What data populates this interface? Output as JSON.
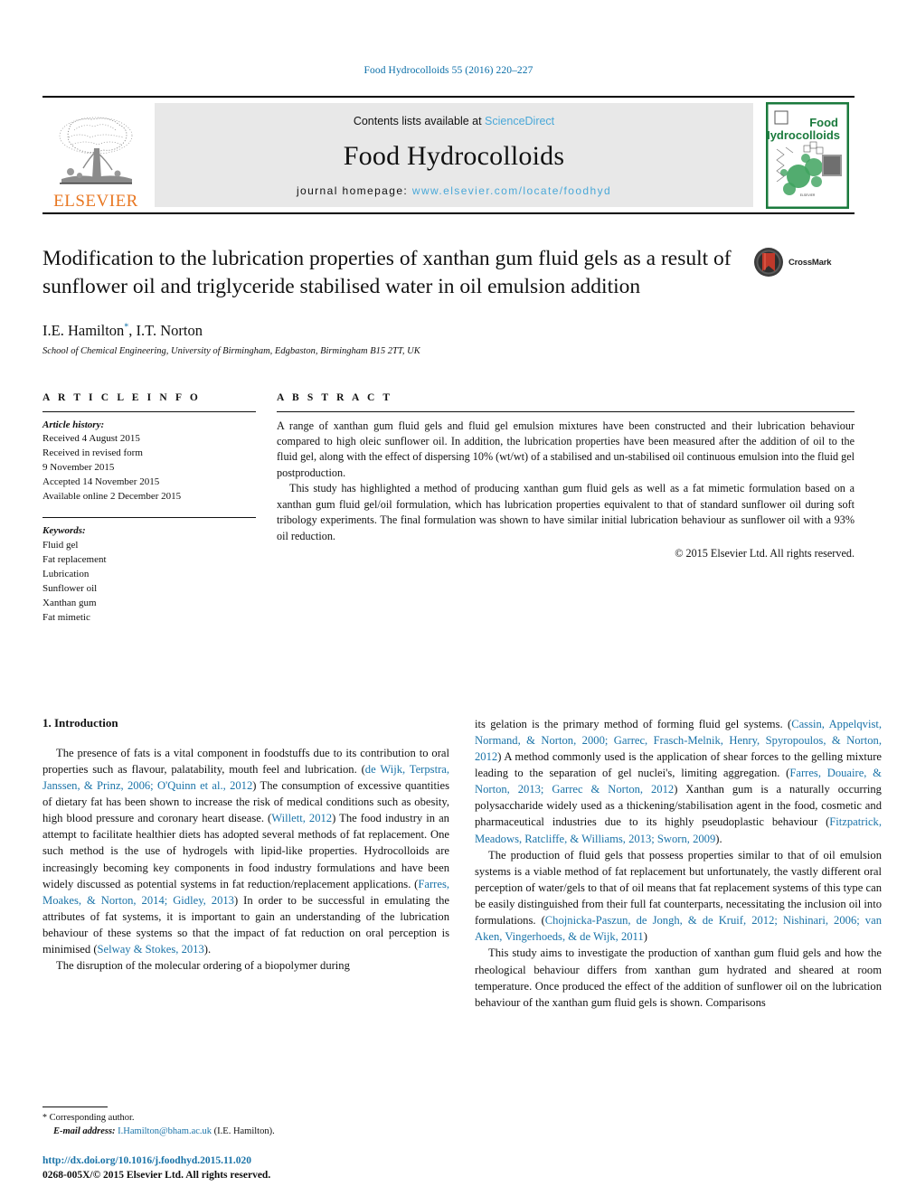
{
  "running_head": "Food Hydrocolloids 55 (2016) 220–227",
  "masthead": {
    "publisher_wordmark": "ELSEVIER",
    "contents_prefix": "Contents lists available at ",
    "contents_link": "ScienceDirect",
    "journal_title": "Food Hydrocolloids",
    "homepage_label": "journal homepage: ",
    "homepage_url": "www.elsevier.com/locate/foodhyd",
    "cover_title_line1": "Food",
    "cover_title_line2": "Hydrocolloids"
  },
  "article": {
    "title": "Modification to the lubrication properties of xanthan gum fluid gels as a result of sunflower oil and triglyceride stabilised water in oil emulsion addition",
    "authors": "I.E. Hamilton, I.T. Norton",
    "author_first": "I.E. Hamilton",
    "author_second": ", I.T. Norton",
    "corresponding_marker": "*",
    "affiliation": "School of Chemical Engineering, University of Birmingham, Edgbaston, Birmingham B15 2TT, UK",
    "crossmark_label": "CrossMark"
  },
  "article_info": {
    "heading": "A R T I C L E   I N F O",
    "history_label": "Article history:",
    "history": [
      "Received 4 August 2015",
      "Received in revised form",
      "9 November 2015",
      "Accepted 14 November 2015",
      "Available online 2 December 2015"
    ],
    "keywords_label": "Keywords:",
    "keywords": [
      "Fluid gel",
      "Fat replacement",
      "Lubrication",
      "Sunflower oil",
      "Xanthan gum",
      "Fat mimetic"
    ]
  },
  "abstract": {
    "heading": "A B S T R A C T",
    "paragraph_1": "A range of xanthan gum fluid gels and fluid gel emulsion mixtures have been constructed and their lubrication behaviour compared to high oleic sunflower oil. In addition, the lubrication properties have been measured after the addition of oil to the fluid gel, along with the effect of dispersing 10% (wt/wt) of a stabilised and un-stabilised oil continuous emulsion into the fluid gel postproduction.",
    "paragraph_2": "This study has highlighted a method of producing xanthan gum fluid gels as well as a fat mimetic formulation based on a xanthan gum fluid gel/oil formulation, which has lubrication properties equivalent to that of standard sunflower oil during soft tribology experiments. The final formulation was shown to have similar initial lubrication behaviour as sunflower oil with a 93% oil reduction.",
    "copyright": "© 2015 Elsevier Ltd. All rights reserved."
  },
  "body": {
    "section_heading": "1. Introduction",
    "left_p1_a": "The presence of fats is a vital component in foodstuffs due to its contribution to oral properties such as flavour, palatability, mouth feel and lubrication. (",
    "left_p1_cit1": "de Wijk, Terpstra, Janssen, & Prinz, 2006; O'Quinn et al., 2012",
    "left_p1_b": ") The consumption of excessive quantities of dietary fat has been shown to increase the risk of medical conditions such as obesity, high blood pressure and coronary heart disease. (",
    "left_p1_cit2": "Willett, 2012",
    "left_p1_c": ") The food industry in an attempt to facilitate healthier diets has adopted several methods of fat replacement. One such method is the use of hydrogels with lipid-like properties. Hydrocolloids are increasingly becoming key components in food industry formulations and have been widely discussed as potential systems in fat reduction/replacement applications. (",
    "left_p1_cit3": "Farres, Moakes, & Norton, 2014; Gidley, 2013",
    "left_p1_d": ") In order to be successful in emulating the attributes of fat systems, it is important to gain an understanding of the lubrication behaviour of these systems so that the impact of fat reduction on oral perception is minimised (",
    "left_p1_cit4": "Selway & Stokes, 2013",
    "left_p1_e": ").",
    "left_p2": "The disruption of the molecular ordering of a biopolymer during",
    "right_p1_a": "its gelation is the primary method of forming fluid gel systems. (",
    "right_p1_cit1": "Cassin, Appelqvist, Normand, & Norton, 2000; Garrec, Frasch-Melnik, Henry, Spyropoulos, & Norton, 2012",
    "right_p1_b": ") A method commonly used is the application of shear forces to the gelling mixture leading to the separation of gel nuclei's, limiting aggregation. (",
    "right_p1_cit2": "Farres, Douaire, & Norton, 2013; Garrec & Norton, 2012",
    "right_p1_c": ") Xanthan gum is a naturally occurring polysaccharide widely used as a thickening/stabilisation agent in the food, cosmetic and pharmaceutical industries due to its highly pseudoplastic behaviour (",
    "right_p1_cit3": "Fitzpatrick, Meadows, Ratcliffe, & Williams, 2013; Sworn, 2009",
    "right_p1_d": ").",
    "right_p2_a": "The production of fluid gels that possess properties similar to that of oil emulsion systems is a viable method of fat replacement but unfortunately, the vastly different oral perception of water/gels to that of oil means that fat replacement systems of this type can be easily distinguished from their full fat counterparts, necessitating the inclusion oil into formulations. (",
    "right_p2_cit1": "Chojnicka-Paszun, de Jongh, & de Kruif, 2012; Nishinari, 2006; van Aken, Vingerhoeds, & de Wijk, 2011",
    "right_p2_b": ")",
    "right_p3": "This study aims to investigate the production of xanthan gum fluid gels and how the rheological behaviour differs from xanthan gum hydrated and sheared at room temperature. Once produced the effect of the addition of sunflower oil on the lubrication behaviour of the xanthan gum fluid gels is shown. Comparisons"
  },
  "footnotes": {
    "corresponding_star": "*",
    "corresponding_text": "Corresponding author.",
    "email_label": "E-mail address:",
    "email": "I.Hamilton@bham.ac.uk",
    "email_suffix": "(I.E. Hamilton).",
    "doi": "http://dx.doi.org/10.1016/j.foodhyd.2015.11.020",
    "issn_copyright": "0268-005X/© 2015 Elsevier Ltd. All rights reserved."
  },
  "colors": {
    "link_blue": "#1a73a8",
    "sciencedirect_blue": "#4aa8d8",
    "elsevier_orange": "#E87722",
    "journal_green": "#1a7a3c",
    "crossmark_red": "#c0392b"
  }
}
